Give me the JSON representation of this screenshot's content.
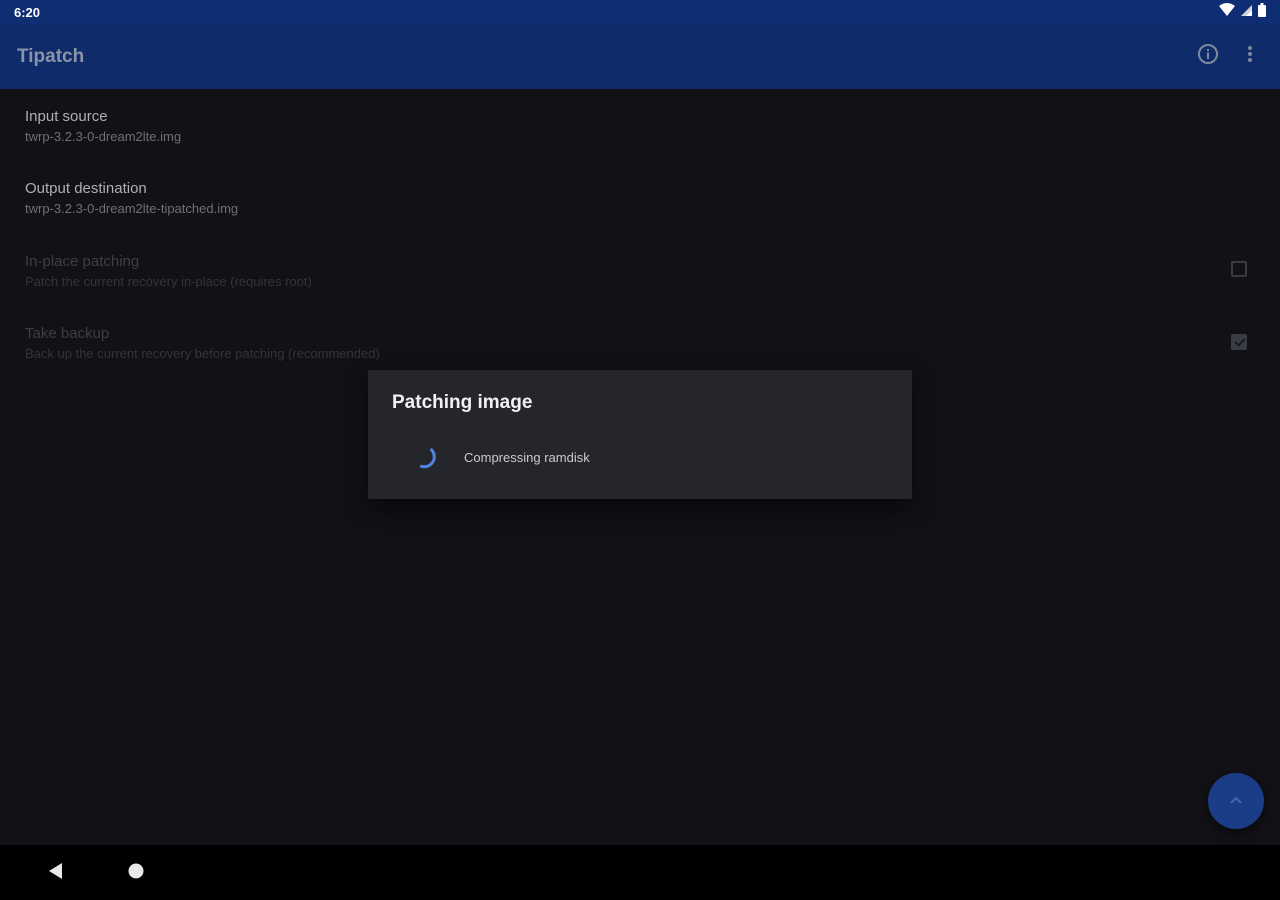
{
  "status_bar": {
    "time": "6:20",
    "icons": [
      "wifi-icon",
      "signal-icon",
      "battery-icon"
    ]
  },
  "app_bar": {
    "title": "Tipatch",
    "actions": [
      "info-icon",
      "overflow-menu-icon"
    ]
  },
  "preferences": [
    {
      "title": "Input source",
      "summary": "twrp-3.2.3-0-dream2lte.img",
      "enabled": true
    },
    {
      "title": "Output destination",
      "summary": "twrp-3.2.3-0-dream2lte-tipatched.img",
      "enabled": true
    },
    {
      "title": "In-place patching",
      "summary": "Patch the current recovery in-place (requires root)",
      "enabled": false,
      "checked": false
    },
    {
      "title": "Take backup",
      "summary": "Back up the current recovery before patching (recommended)",
      "enabled": false,
      "checked": true
    }
  ],
  "dialog": {
    "title": "Patching image",
    "message": "Compressing ramdisk"
  },
  "fab": {
    "icon": "chevron-up-icon"
  },
  "nav_bar": {
    "buttons": [
      "back-icon",
      "home-icon"
    ]
  },
  "colors": {
    "status_bar": "#0f2d73",
    "app_bar": "#0f2b6a",
    "background": "#111116",
    "dialog": "#25262c",
    "accent": "#4f84e0",
    "fab": "#1b3c86"
  }
}
